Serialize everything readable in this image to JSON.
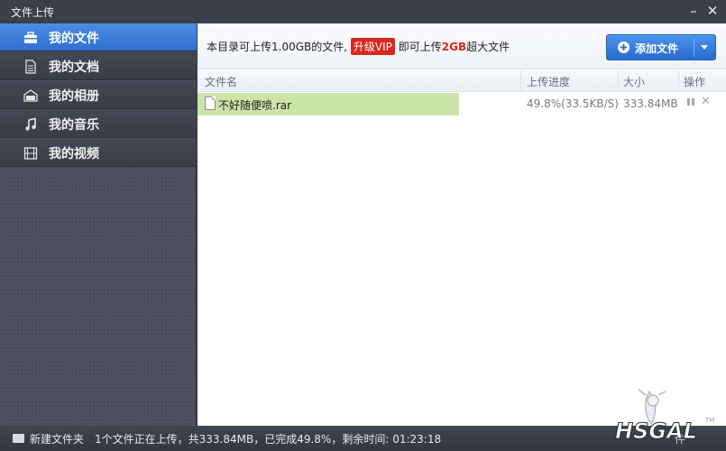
{
  "window": {
    "title": "文件上传",
    "minimize": "–",
    "close": "✕"
  },
  "sidebar": {
    "items": [
      {
        "label": "我的文件",
        "icon": "briefcase-icon",
        "active": true
      },
      {
        "label": "我的文档",
        "icon": "document-icon",
        "active": false
      },
      {
        "label": "我的相册",
        "icon": "photo-album-icon",
        "active": false
      },
      {
        "label": "我的音乐",
        "icon": "music-note-icon",
        "active": false
      },
      {
        "label": "我的视频",
        "icon": "film-icon",
        "active": false
      }
    ]
  },
  "notice": {
    "prefix": "本目录可上传1.00GB的文件,",
    "vip_label": "升级VIP",
    "middle": "即可上传",
    "highlight": "2GB",
    "suffix": "超大文件"
  },
  "toolbar": {
    "add_label": "添加文件"
  },
  "table": {
    "headers": {
      "name": "文件名",
      "progress": "上传进度",
      "size": "大小",
      "actions": "操作"
    },
    "rows": [
      {
        "name": "不好随便喷.rar",
        "progress_text": "49.8%(33.5KB/S)",
        "progress": 0.498,
        "size": "333.84MB"
      }
    ]
  },
  "status": {
    "new_folder": "新建文件夹",
    "text": "1个文件正在上传，共333.84MB，已完成49.8%，剩余时间: 01:23:18",
    "right": "件"
  },
  "watermark": {
    "text": "HSGAL",
    "tm": "TM"
  },
  "colors": {
    "accent": "#2f6fd0",
    "vip": "#d9281e",
    "progress_fill": "#cde4a7"
  }
}
